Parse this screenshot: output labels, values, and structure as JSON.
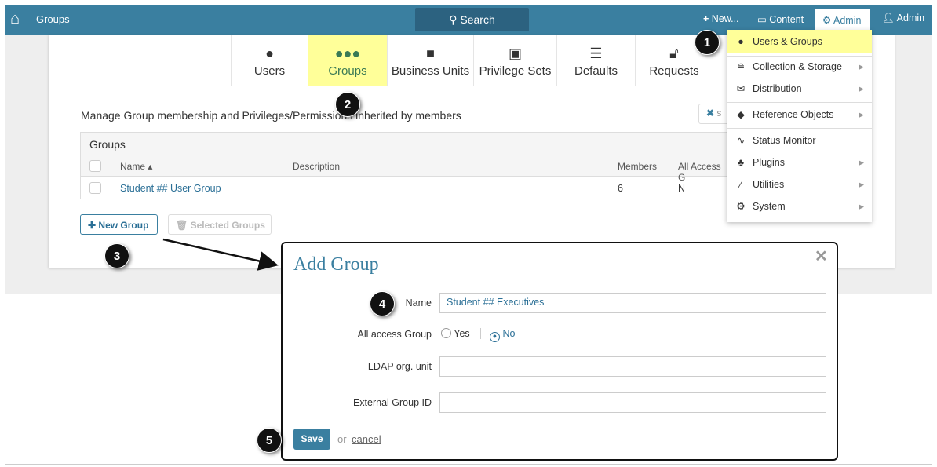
{
  "topbar": {
    "title": "Groups",
    "search": "Search",
    "new": "New...",
    "content": "Content",
    "admin_menu": "Admin",
    "user": "Admin"
  },
  "tabs": [
    {
      "label": "Users"
    },
    {
      "label": "Groups"
    },
    {
      "label": "Business Units"
    },
    {
      "label": "Privilege Sets"
    },
    {
      "label": "Defaults"
    },
    {
      "label": "Requests"
    }
  ],
  "main": {
    "description": "Manage Group membership and Privileges/Permissions inherited by members",
    "side_button": "s",
    "table": {
      "title": "Groups",
      "columns": [
        "Name ▴",
        "Description",
        "Members",
        "All Access G"
      ],
      "rows": [
        {
          "name": "Student ## User Group",
          "description": "",
          "members": "6",
          "all_access": "N"
        }
      ]
    },
    "new_group": "New Group",
    "selected_groups": "Selected Groups"
  },
  "admin_menu": [
    {
      "label": "Users & Groups"
    },
    {
      "label": "Collection & Storage"
    },
    {
      "label": "Distribution"
    },
    {
      "label": "Reference Objects"
    },
    {
      "label": "Status Monitor"
    },
    {
      "label": "Plugins"
    },
    {
      "label": "Utilities"
    },
    {
      "label": "System"
    }
  ],
  "modal": {
    "title": "Add Group",
    "name_label": "Name",
    "name_value": "Student ## Executives",
    "all_access_label": "All access Group",
    "yes": "Yes",
    "no": "No",
    "ldap_label": "LDAP org. unit",
    "ext_label": "External Group ID",
    "save": "Save",
    "or": "or",
    "cancel": "cancel",
    "close": "✕"
  },
  "callouts": [
    "1",
    "2",
    "3",
    "4",
    "5"
  ]
}
